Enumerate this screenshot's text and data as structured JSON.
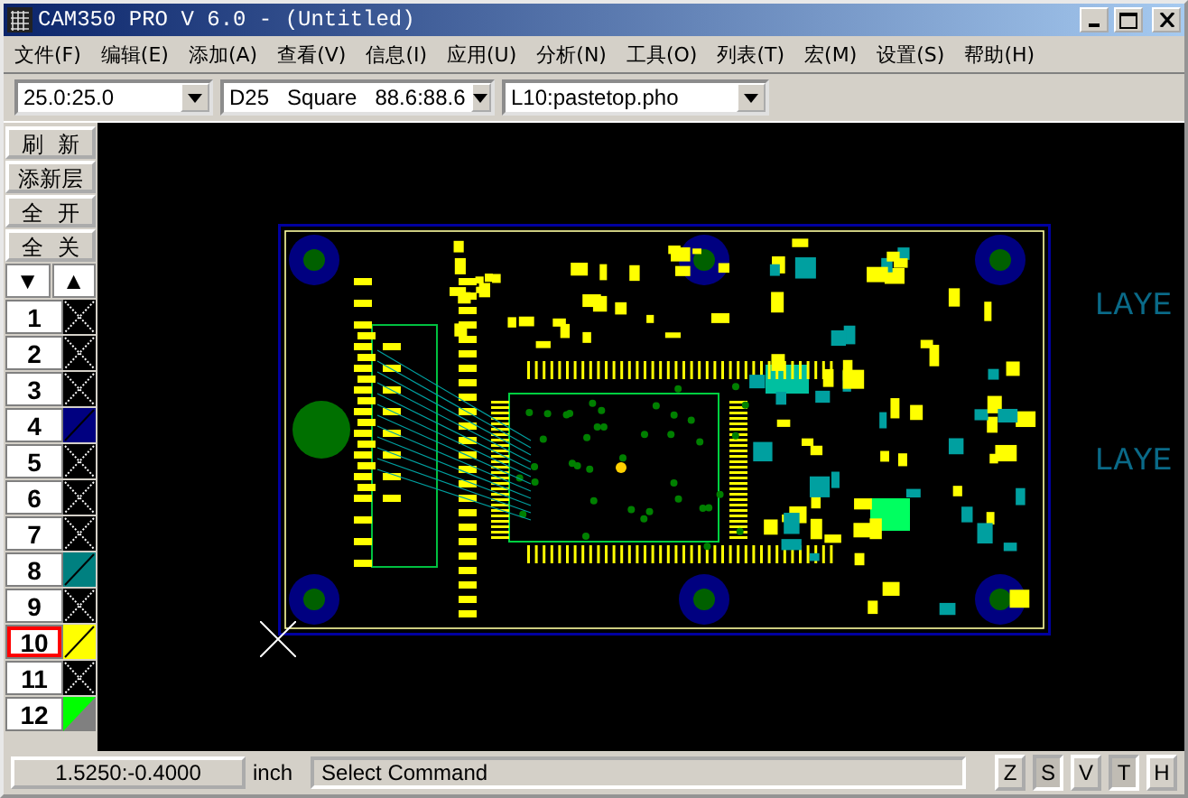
{
  "window": {
    "title": "CAM350 PRO V 6.0 - (Untitled)"
  },
  "menu": [
    "文件(F)",
    "编辑(E)",
    "添加(A)",
    "查看(V)",
    "信息(I)",
    "应用(U)",
    "分析(N)",
    "工具(O)",
    "列表(T)",
    "宏(M)",
    "设置(S)",
    "帮助(H)"
  ],
  "toolbar": {
    "combos": [
      {
        "value": "25.0:25.0"
      },
      {
        "value": "D25   Square   88.6:88.6"
      },
      {
        "value": "L10:pastetop.pho"
      }
    ]
  },
  "layer_panel": {
    "buttons": [
      "刷  新",
      "添新层",
      "全  开",
      "全  关"
    ],
    "order_buttons": [
      "▼",
      "▲"
    ],
    "layers": [
      {
        "number": "1",
        "kind": "empty",
        "selected": false
      },
      {
        "number": "2",
        "kind": "empty",
        "selected": false
      },
      {
        "number": "3",
        "kind": "empty",
        "selected": false
      },
      {
        "number": "4",
        "kind": "color",
        "color": "#000080",
        "selected": false
      },
      {
        "number": "5",
        "kind": "empty",
        "selected": false
      },
      {
        "number": "6",
        "kind": "empty",
        "selected": false
      },
      {
        "number": "7",
        "kind": "empty",
        "selected": false
      },
      {
        "number": "8",
        "kind": "color",
        "color": "#008080",
        "selected": false
      },
      {
        "number": "9",
        "kind": "empty",
        "selected": false
      },
      {
        "number": "10",
        "kind": "color",
        "color": "#ffff00",
        "selected": true
      },
      {
        "number": "11",
        "kind": "empty",
        "selected": false
      },
      {
        "number": "12",
        "kind": "split",
        "color": "#00ff00",
        "selected": false
      }
    ]
  },
  "canvas": {
    "labels": [
      "LAYE",
      "LAYE"
    ]
  },
  "status_bar": {
    "coordinates": "1.5250:-0.4000",
    "unit": "inch",
    "message": "Select Command",
    "mode_buttons": [
      {
        "label": "Z",
        "pressed": false
      },
      {
        "label": "S",
        "pressed": true
      },
      {
        "label": "V",
        "pressed": false
      },
      {
        "label": "T",
        "pressed": true
      },
      {
        "label": "H",
        "pressed": false
      }
    ]
  }
}
